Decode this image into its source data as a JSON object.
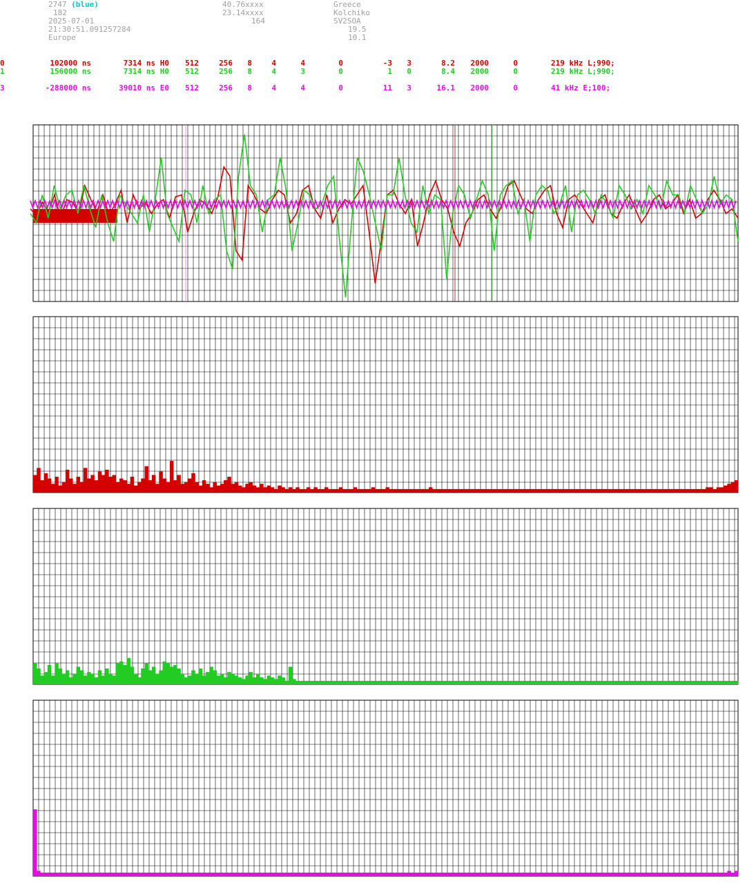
{
  "header": {
    "station_id": "2747",
    "station_tag": "(blue)",
    "line2": "182",
    "date": "2025-07-01",
    "time": "21:30:51.091257284",
    "region": "Europe",
    "lat": "40.76xxxx",
    "lon": "23.14xxxx",
    "alt": "164",
    "country": "Greece",
    "place": "Kolchiko",
    "callsign": "SV2SOA",
    "val1": "19.5",
    "val2": "10.1"
  },
  "channels": [
    {
      "id": "0",
      "delay": "102000 ns",
      "res": "7314 ns H0",
      "n1": "512",
      "n2": "256",
      "n3": "8",
      "n4": "4",
      "n5": "4",
      "n6": "0",
      "n7": "-3",
      "n8": "3",
      "snr": "8.2",
      "rate": "2000",
      "z": "0",
      "band": "219 kHz L;990;",
      "color": "#d40000"
    },
    {
      "id": "1",
      "delay": "156000 ns",
      "res": "7314 ns H0",
      "n1": "512",
      "n2": "256",
      "n3": "8",
      "n4": "4",
      "n5": "3",
      "n6": "0",
      "n7": "1",
      "n8": "0",
      "snr": "8.4",
      "rate": "2000",
      "z": "0",
      "band": "219 kHz L;990;",
      "color": "#22cc22"
    },
    {
      "id": "3",
      "delay": "-288000 ns",
      "res": "39010 ns E0",
      "n1": "512",
      "n2": "256",
      "n3": "8",
      "n4": "4",
      "n5": "4",
      "n6": "0",
      "n7": "11",
      "n8": "3",
      "snr": "16.1",
      "rate": "2000",
      "z": "0",
      "band": "41 kHz E;100;",
      "color": "#e010e0"
    }
  ],
  "colors": {
    "red": "#d40000",
    "green": "#22cc22",
    "magenta": "#e010e0",
    "grid": "#000000"
  },
  "chart_data": [
    {
      "type": "line",
      "ylim": [
        -1,
        1
      ],
      "grid": true,
      "series": [
        {
          "values": [
            -0.05,
            -0.12,
            0.02,
            -0.08,
            0.1,
            -0.15,
            0.05,
            0.02,
            -0.1,
            0.2,
            0.05,
            -0.08,
            0.1,
            -0.12,
            0.0,
            0.15,
            -0.2,
            0.1,
            -0.05,
            0.02,
            -0.1,
            0.0,
            0.05,
            -0.15,
            0.08,
            0.1,
            -0.3,
            -0.1,
            0.05,
            0.0,
            -0.1,
            0.08,
            0.4,
            0.3,
            -0.5,
            -0.6,
            0.2,
            0.1,
            -0.05,
            -0.1,
            0.05,
            0.15,
            0.1,
            -0.2,
            -0.1,
            0.15,
            0.2,
            -0.05,
            -0.15,
            0.1,
            -0.2,
            -0.05,
            0.05,
            0.0,
            0.1,
            0.2,
            -0.3,
            -0.85,
            -0.4,
            0.1,
            0.15,
            0.0,
            -0.1,
            0.05,
            -0.45,
            -0.2,
            0.1,
            0.25,
            0.05,
            -0.05,
            -0.3,
            -0.45,
            -0.2,
            -0.1,
            0.05,
            0.1,
            -0.05,
            -0.15,
            0.0,
            0.2,
            0.25,
            0.1,
            -0.05,
            -0.1,
            0.05,
            0.15,
            0.2,
            -0.1,
            -0.25,
            0.05,
            0.1,
            0.0,
            -0.1,
            -0.2,
            0.05,
            0.1,
            -0.1,
            -0.15,
            0.0,
            0.1,
            -0.05,
            -0.2,
            -0.1,
            0.05,
            0.1,
            -0.05,
            0.0,
            0.1,
            -0.1,
            0.05,
            -0.15,
            -0.1,
            0.05,
            0.15,
            0.05,
            -0.1,
            -0.05,
            -0.15
          ]
        },
        {
          "values": [
            -0.1,
            -0.2,
            0.1,
            -0.15,
            0.2,
            -0.05,
            0.1,
            0.15,
            -0.1,
            0.2,
            -0.05,
            -0.25,
            0.1,
            -0.2,
            -0.4,
            0.1,
            0.0,
            -0.1,
            -0.2,
            0.1,
            -0.3,
            0.05,
            0.5,
            -0.1,
            -0.25,
            -0.4,
            0.15,
            0.1,
            -0.2,
            0.2,
            -0.1,
            0.05,
            0.1,
            -0.5,
            -0.7,
            0.3,
            0.75,
            0.2,
            0.1,
            -0.3,
            0.05,
            0.1,
            0.5,
            0.15,
            -0.5,
            -0.2,
            0.15,
            0.1,
            -0.05,
            0.0,
            0.2,
            0.3,
            -0.4,
            -1.0,
            -0.2,
            0.5,
            0.35,
            0.1,
            -0.2,
            -0.5,
            0.1,
            0.1,
            0.5,
            0.1,
            -0.2,
            -0.3,
            0.2,
            -0.1,
            0.1,
            0.05,
            -0.8,
            -0.1,
            0.2,
            0.1,
            -0.15,
            0.05,
            0.25,
            0.1,
            -0.5,
            0.1,
            0.2,
            0.25,
            -0.1,
            0.05,
            -0.4,
            0.1,
            0.2,
            0.15,
            -0.1,
            0.0,
            0.2,
            -0.3,
            0.1,
            0.15,
            0.05,
            -0.1,
            0.1,
            0.0,
            -0.15,
            0.2,
            0.1,
            -0.05,
            0.05,
            -0.1,
            0.2,
            0.1,
            -0.05,
            0.25,
            0.1,
            0.1,
            -0.1,
            0.2,
            0.05,
            -0.1,
            0.0,
            0.3,
            0.0,
            0.1,
            0.05,
            -0.4
          ]
        },
        {
          "values": [
            0.0,
            0.0,
            0.0,
            0.0,
            0.0,
            0.0,
            0.0,
            0.0,
            0.0,
            0.0
          ]
        }
      ]
    },
    {
      "type": "bar",
      "ylim": [
        0,
        1
      ],
      "values": [
        0.1,
        0.14,
        0.07,
        0.11,
        0.08,
        0.05,
        0.09,
        0.04,
        0.06,
        0.13,
        0.08,
        0.05,
        0.09,
        0.06,
        0.14,
        0.08,
        0.1,
        0.07,
        0.12,
        0.1,
        0.13,
        0.09,
        0.1,
        0.06,
        0.08,
        0.07,
        0.05,
        0.09,
        0.04,
        0.06,
        0.08,
        0.15,
        0.07,
        0.1,
        0.05,
        0.12,
        0.08,
        0.06,
        0.18,
        0.07,
        0.1,
        0.05,
        0.06,
        0.08,
        0.11,
        0.06,
        0.04,
        0.07,
        0.05,
        0.03,
        0.06,
        0.04,
        0.05,
        0.07,
        0.09,
        0.05,
        0.06,
        0.04,
        0.03,
        0.05,
        0.06,
        0.04,
        0.03,
        0.05,
        0.03,
        0.04,
        0.03,
        0.02,
        0.04,
        0.03,
        0.02,
        0.03,
        0.02,
        0.03,
        0.02,
        0.02,
        0.03,
        0.02,
        0.03,
        0.02,
        0.02,
        0.03,
        0.02,
        0.02,
        0.02,
        0.03,
        0.02,
        0.02,
        0.02,
        0.03,
        0.02,
        0.02,
        0.02,
        0.02,
        0.03,
        0.02,
        0.02,
        0.02,
        0.03,
        0.02,
        0.02,
        0.02,
        0.02,
        0.02,
        0.02,
        0.02,
        0.02,
        0.02,
        0.02,
        0.02,
        0.03,
        0.02,
        0.02,
        0.02,
        0.02,
        0.02,
        0.02,
        0.02,
        0.02,
        0.02,
        0.02,
        0.02,
        0.02,
        0.02,
        0.02,
        0.02,
        0.02,
        0.02,
        0.02,
        0.02,
        0.02,
        0.02,
        0.02,
        0.02,
        0.02,
        0.02,
        0.02,
        0.02,
        0.02,
        0.02,
        0.02,
        0.02,
        0.02,
        0.02,
        0.02,
        0.02,
        0.02,
        0.02,
        0.02,
        0.02,
        0.02,
        0.02,
        0.02,
        0.02,
        0.02,
        0.02,
        0.02,
        0.02,
        0.02,
        0.02,
        0.02,
        0.02,
        0.02,
        0.02,
        0.02,
        0.02,
        0.02,
        0.02,
        0.02,
        0.02,
        0.02,
        0.02,
        0.02,
        0.02,
        0.02,
        0.02,
        0.02,
        0.02,
        0.02,
        0.02,
        0.02,
        0.02,
        0.02,
        0.02,
        0.02,
        0.02,
        0.02,
        0.03,
        0.03,
        0.02,
        0.03,
        0.03,
        0.04,
        0.05,
        0.06,
        0.07
      ]
    },
    {
      "type": "bar",
      "ylim": [
        0,
        1
      ],
      "values": [
        0.12,
        0.09,
        0.05,
        0.07,
        0.11,
        0.05,
        0.12,
        0.09,
        0.06,
        0.08,
        0.04,
        0.06,
        0.1,
        0.08,
        0.05,
        0.07,
        0.06,
        0.04,
        0.08,
        0.05,
        0.09,
        0.06,
        0.05,
        0.12,
        0.13,
        0.11,
        0.15,
        0.1,
        0.06,
        0.04,
        0.09,
        0.12,
        0.08,
        0.1,
        0.06,
        0.08,
        0.13,
        0.12,
        0.1,
        0.11,
        0.09,
        0.06,
        0.04,
        0.05,
        0.08,
        0.06,
        0.09,
        0.05,
        0.07,
        0.1,
        0.08,
        0.05,
        0.06,
        0.04,
        0.07,
        0.06,
        0.05,
        0.04,
        0.03,
        0.05,
        0.07,
        0.04,
        0.06,
        0.04,
        0.03,
        0.05,
        0.04,
        0.03,
        0.05,
        0.04,
        0.02,
        0.1,
        0.03,
        0.02,
        0.02,
        0.02,
        0.02,
        0.02,
        0.02,
        0.02,
        0.02,
        0.02,
        0.02,
        0.02,
        0.02,
        0.02,
        0.02,
        0.02,
        0.02,
        0.02,
        0.02,
        0.02,
        0.02,
        0.02,
        0.02,
        0.02,
        0.02,
        0.02,
        0.02,
        0.02,
        0.02,
        0.02,
        0.02,
        0.02,
        0.02,
        0.02,
        0.02,
        0.02,
        0.02,
        0.02,
        0.02,
        0.02,
        0.02,
        0.02,
        0.02,
        0.02,
        0.02,
        0.02,
        0.02,
        0.02,
        0.02,
        0.02,
        0.02,
        0.02,
        0.02,
        0.02,
        0.02,
        0.02,
        0.02,
        0.02,
        0.02,
        0.02,
        0.02,
        0.02,
        0.02,
        0.02,
        0.02,
        0.02,
        0.02,
        0.02,
        0.02,
        0.02,
        0.02,
        0.02,
        0.02,
        0.02,
        0.02,
        0.02,
        0.02,
        0.02,
        0.02,
        0.02,
        0.02,
        0.02,
        0.02,
        0.02,
        0.02,
        0.02,
        0.02,
        0.02,
        0.02,
        0.02,
        0.02,
        0.02,
        0.02,
        0.02,
        0.02,
        0.02,
        0.02,
        0.02,
        0.02,
        0.02,
        0.02,
        0.02,
        0.02,
        0.02,
        0.02,
        0.02,
        0.02,
        0.02,
        0.02,
        0.02,
        0.02,
        0.02,
        0.02,
        0.02,
        0.02,
        0.02,
        0.02,
        0.02,
        0.02,
        0.02,
        0.02,
        0.02,
        0.02,
        0.02
      ]
    },
    {
      "type": "bar",
      "ylim": [
        0,
        1
      ],
      "values": [
        0.38,
        0.03,
        0.02,
        0.02,
        0.02,
        0.02,
        0.02,
        0.02,
        0.02,
        0.02,
        0.02,
        0.02,
        0.02,
        0.02,
        0.02,
        0.02,
        0.02,
        0.02,
        0.02,
        0.02,
        0.02,
        0.02,
        0.02,
        0.02,
        0.02,
        0.02,
        0.02,
        0.02,
        0.02,
        0.02,
        0.02,
        0.02,
        0.02,
        0.02,
        0.02,
        0.02,
        0.02,
        0.02,
        0.02,
        0.02,
        0.02,
        0.02,
        0.02,
        0.02,
        0.02,
        0.02,
        0.02,
        0.02,
        0.02,
        0.02,
        0.02,
        0.02,
        0.02,
        0.02,
        0.02,
        0.02,
        0.02,
        0.02,
        0.02,
        0.02,
        0.02,
        0.02,
        0.02,
        0.02,
        0.02,
        0.02,
        0.02,
        0.02,
        0.02,
        0.02,
        0.02,
        0.02,
        0.02,
        0.02,
        0.02,
        0.02,
        0.02,
        0.02,
        0.02,
        0.02,
        0.02,
        0.02,
        0.02,
        0.02,
        0.02,
        0.02,
        0.02,
        0.02,
        0.02,
        0.02,
        0.02,
        0.02,
        0.02,
        0.02,
        0.02,
        0.02,
        0.02,
        0.02,
        0.02,
        0.02,
        0.02,
        0.02,
        0.02,
        0.02,
        0.02,
        0.02,
        0.02,
        0.02,
        0.02,
        0.02,
        0.02,
        0.02,
        0.02,
        0.02,
        0.02,
        0.02,
        0.02,
        0.02,
        0.02,
        0.02,
        0.02,
        0.02,
        0.02,
        0.02,
        0.02,
        0.02,
        0.02,
        0.02,
        0.02,
        0.02,
        0.02,
        0.02,
        0.02,
        0.02,
        0.02,
        0.02,
        0.02,
        0.02,
        0.02,
        0.02,
        0.02,
        0.02,
        0.02,
        0.02,
        0.02,
        0.02,
        0.02,
        0.02,
        0.02,
        0.02,
        0.02,
        0.02,
        0.02,
        0.02,
        0.02,
        0.02,
        0.02,
        0.02,
        0.02,
        0.02,
        0.02,
        0.02,
        0.02,
        0.02,
        0.02,
        0.02,
        0.02,
        0.02,
        0.02,
        0.02,
        0.02,
        0.02,
        0.02,
        0.02,
        0.02,
        0.02,
        0.02,
        0.02,
        0.02,
        0.02,
        0.02,
        0.02,
        0.02,
        0.02,
        0.02,
        0.02,
        0.02,
        0.02,
        0.02,
        0.02,
        0.02,
        0.02,
        0.02,
        0.03,
        0.02,
        0.03
      ]
    }
  ]
}
